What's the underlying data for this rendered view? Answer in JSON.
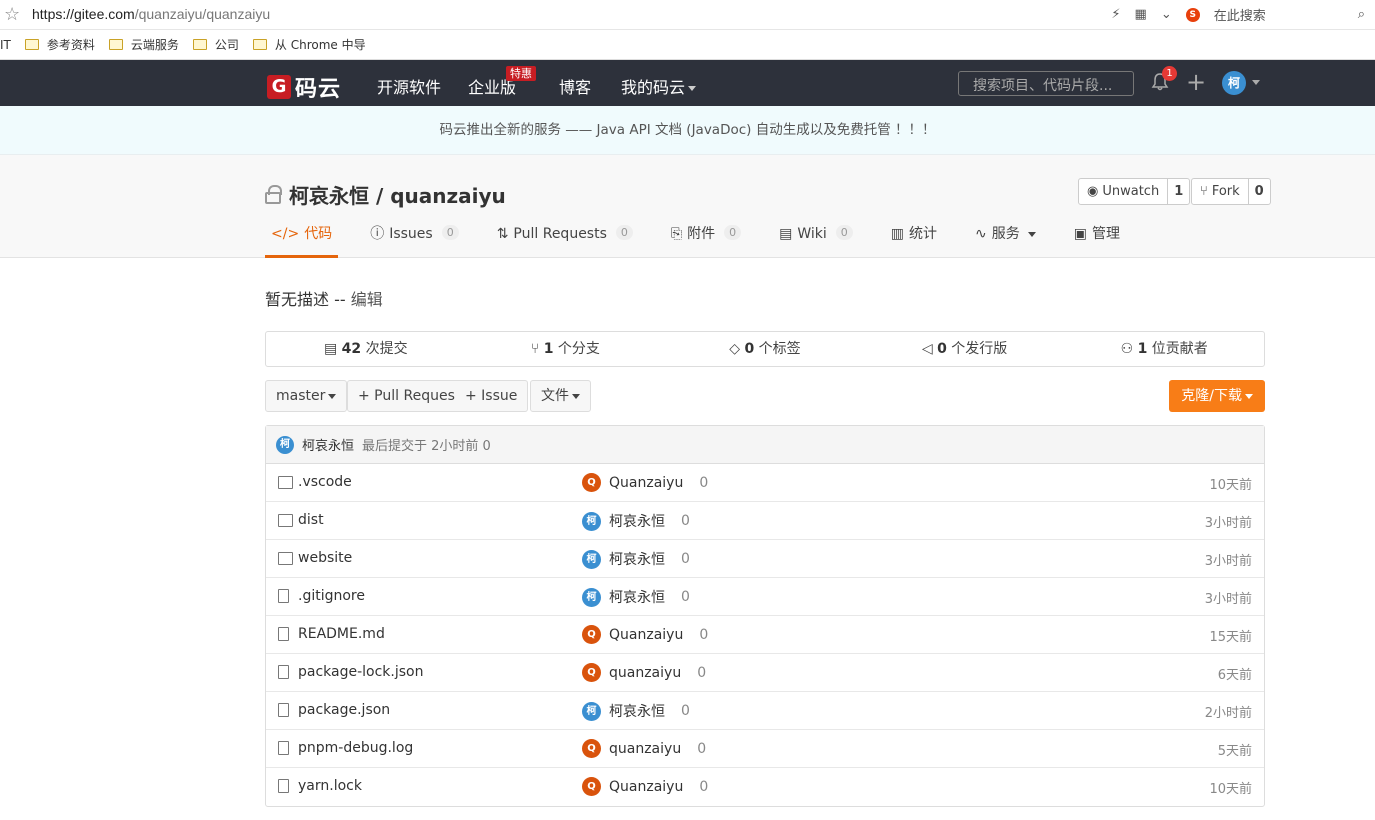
{
  "browser": {
    "url_host": "https://gitee.com",
    "url_path": "/quanzaiyu/quanzaiyu",
    "search_placeholder": "在此搜索"
  },
  "bookmarks": [
    "IT",
    "参考资料",
    "云端服务",
    "公司",
    "从 Chrome 中导"
  ],
  "nav": {
    "logo": "码云",
    "logo_mark": "G",
    "items": [
      "开源软件",
      "企业版",
      "博客",
      "我的码云"
    ],
    "tehui": "特惠",
    "search_placeholder": "搜索项目、代码片段...",
    "notif_count": "1",
    "avatar": "柯"
  },
  "announcement": "码云推出全新的服务 —— Java API 文档 (JavaDoc) 自动生成以及免费托管 ！！！",
  "repo": {
    "title": "柯哀永恒 / quanzaiyu",
    "unwatch": "Unwatch",
    "watch_count": "1",
    "fork": "Fork",
    "fork_count": "0",
    "tabs": [
      {
        "label": "代码",
        "icon": "</>",
        "count": ""
      },
      {
        "label": "Issues",
        "icon": "ⓘ",
        "count": "0"
      },
      {
        "label": "Pull Requests",
        "icon": "⇅",
        "count": "0"
      },
      {
        "label": "附件",
        "icon": "⎘",
        "count": "0"
      },
      {
        "label": "Wiki",
        "icon": "▤",
        "count": "0"
      },
      {
        "label": "统计",
        "icon": "▥",
        "count": ""
      },
      {
        "label": "服务",
        "icon": "∿",
        "count": ""
      },
      {
        "label": "管理",
        "icon": "▣",
        "count": ""
      }
    ],
    "desc": "暂无描述 -- ",
    "desc_edit": "编辑",
    "stats": [
      {
        "num": "42",
        "label": " 次提交"
      },
      {
        "num": "1",
        "label": " 个分支"
      },
      {
        "num": "0",
        "label": " 个标签"
      },
      {
        "num": "0",
        "label": " 个发行版"
      },
      {
        "num": "1",
        "label": " 位贡献者"
      }
    ],
    "branch": "master",
    "pull_request": "+ Pull Request",
    "issue": "+ Issue",
    "files_btn": "文件",
    "clone": "克隆/下载",
    "last_commit_author": "柯哀永恒",
    "last_commit_text": "最后提交于 2小时前 0"
  },
  "files": [
    {
      "name": ".vscode",
      "type": "folder",
      "author": "Quanzaiyu",
      "avatar": "Q",
      "color": "orange",
      "msg": "0",
      "time": "10天前"
    },
    {
      "name": "dist",
      "type": "folder",
      "author": "柯哀永恒",
      "avatar": "柯",
      "color": "blue",
      "msg": "0",
      "time": "3小时前"
    },
    {
      "name": "website",
      "type": "folder",
      "author": "柯哀永恒",
      "avatar": "柯",
      "color": "blue",
      "msg": "0",
      "time": "3小时前"
    },
    {
      "name": ".gitignore",
      "type": "file",
      "author": "柯哀永恒",
      "avatar": "柯",
      "color": "blue",
      "msg": "0",
      "time": "3小时前"
    },
    {
      "name": "README.md",
      "type": "file",
      "author": "Quanzaiyu",
      "avatar": "Q",
      "color": "orange",
      "msg": "0",
      "time": "15天前"
    },
    {
      "name": "package-lock.json",
      "type": "file",
      "author": "quanzaiyu",
      "avatar": "Q",
      "color": "orange",
      "msg": "0",
      "time": "6天前"
    },
    {
      "name": "package.json",
      "type": "file",
      "author": "柯哀永恒",
      "avatar": "柯",
      "color": "blue",
      "msg": "0",
      "time": "2小时前"
    },
    {
      "name": "pnpm-debug.log",
      "type": "file",
      "author": "quanzaiyu",
      "avatar": "Q",
      "color": "orange",
      "msg": "0",
      "time": "5天前"
    },
    {
      "name": "yarn.lock",
      "type": "file",
      "author": "Quanzaiyu",
      "avatar": "Q",
      "color": "orange",
      "msg": "0",
      "time": "10天前"
    }
  ]
}
